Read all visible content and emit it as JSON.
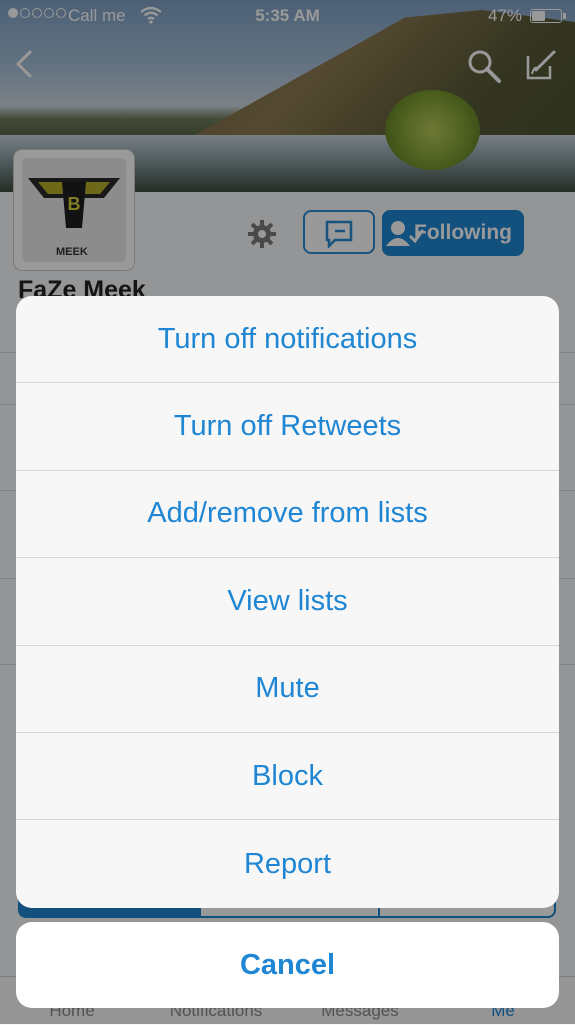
{
  "status_bar": {
    "carrier": "Call me",
    "time": "5:35 AM",
    "battery": "47%",
    "battery_level": 0.47,
    "signal_bars": 1
  },
  "profile": {
    "name": "FaZe Meek",
    "avatar_text": "MEEK",
    "following_label": "Following"
  },
  "action_sheet": {
    "items": [
      "Turn off notifications",
      "Turn off Retweets",
      "Add/remove from lists",
      "View lists",
      "Mute",
      "Block",
      "Report"
    ],
    "cancel_label": "Cancel"
  },
  "tab_bar": {
    "tabs": [
      "Home",
      "Notifications",
      "Messages",
      "Me"
    ],
    "active": "Me"
  },
  "colors": {
    "accent": "#1f86d3",
    "sheet_bg": "#f7f7f7"
  }
}
